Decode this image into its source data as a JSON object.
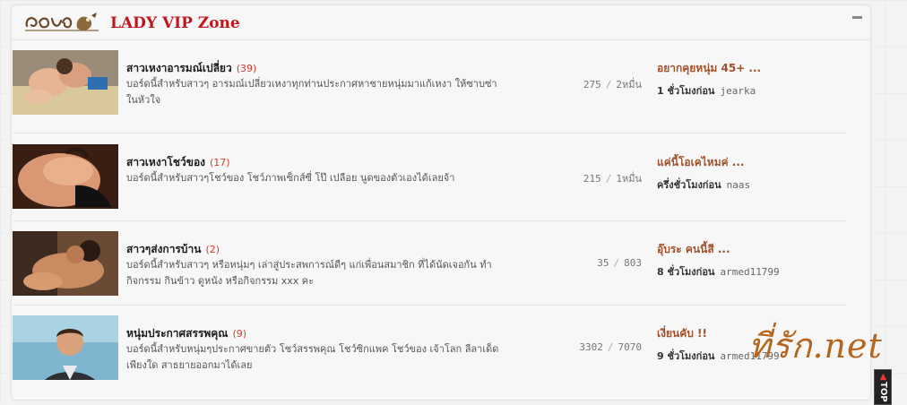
{
  "zone": {
    "title": "LADY VIP Zone"
  },
  "forums": [
    {
      "title": "สาวเหงาอารมณ์เปลี่ยว",
      "count": "(39)",
      "description": "บอร์ดนี้สำหรับสาวๆ อารมณ์เปลี่ยวเหงาทุกท่านประกาศหาชายหนุ่มมาแก้เหงา ให้ซาบซ่าในหัวใจ",
      "topics": "275",
      "posts": "2หมื่น",
      "last_title": "อยากคุยหนุ่ม 45+ ...",
      "last_when": "1 ชั่วโมงก่อน",
      "last_user": "jearka"
    },
    {
      "title": "สาวเหงาโชว์ของ",
      "count": "(17)",
      "description": "บอร์ดนี้สำหรับสาวๆโชว์ของ โชว์ภาพเซ็กส์ซี่ โป๊ เปลือย นูดของตัวเองได้เลยจ้า",
      "topics": "215",
      "posts": "1หมื่น",
      "last_title": "แค่นี้โอเคไหมค่ ...",
      "last_when": "ครึ่งชั่วโมงก่อน",
      "last_user": "naas"
    },
    {
      "title": "สาวๆส่งการบ้าน",
      "count": "(2)",
      "description": "บอร์ดนี้สำหรับสาวๆ หรือหนุ่มๆ เล่าสู่ประสพการณ์ดีๆ แก่เพื่อนสมาชิก ที่ได้นัดเจอกัน ทำกิจกรรม กินข้าว ดูหนัง หรือกิจกรรม xxx คะ",
      "topics": "35",
      "posts": "803",
      "last_title": "อุ๊บระ คนนี้สี ...",
      "last_when": "8 ชั่วโมงก่อน",
      "last_user": "armed11799"
    },
    {
      "title": "หนุ่มประกาศสรรพคุณ",
      "count": "(9)",
      "description": "บอร์ดนี้สำหรับหนุ่มๆประกาศขายตัว โชว์สรรพคุณ โชว์ซิกแพค โชว์ของ เจ้าโลก ลีลาเด็ดเพียงใด สาธยายออกมาได้เลย",
      "topics": "3302",
      "posts": "7070",
      "last_title": "เงี่ยนคับ !!",
      "last_when": "9 ชั่วโมงก่อน",
      "last_user": "armed11799"
    }
  ],
  "watermark": "ที่รัก.net",
  "to_top_label": "TOP",
  "colors": {
    "zone_title": "#c0171c",
    "count": "#d23a2c",
    "last_post_title": "#a0522d",
    "watermark": "#b5651d"
  }
}
